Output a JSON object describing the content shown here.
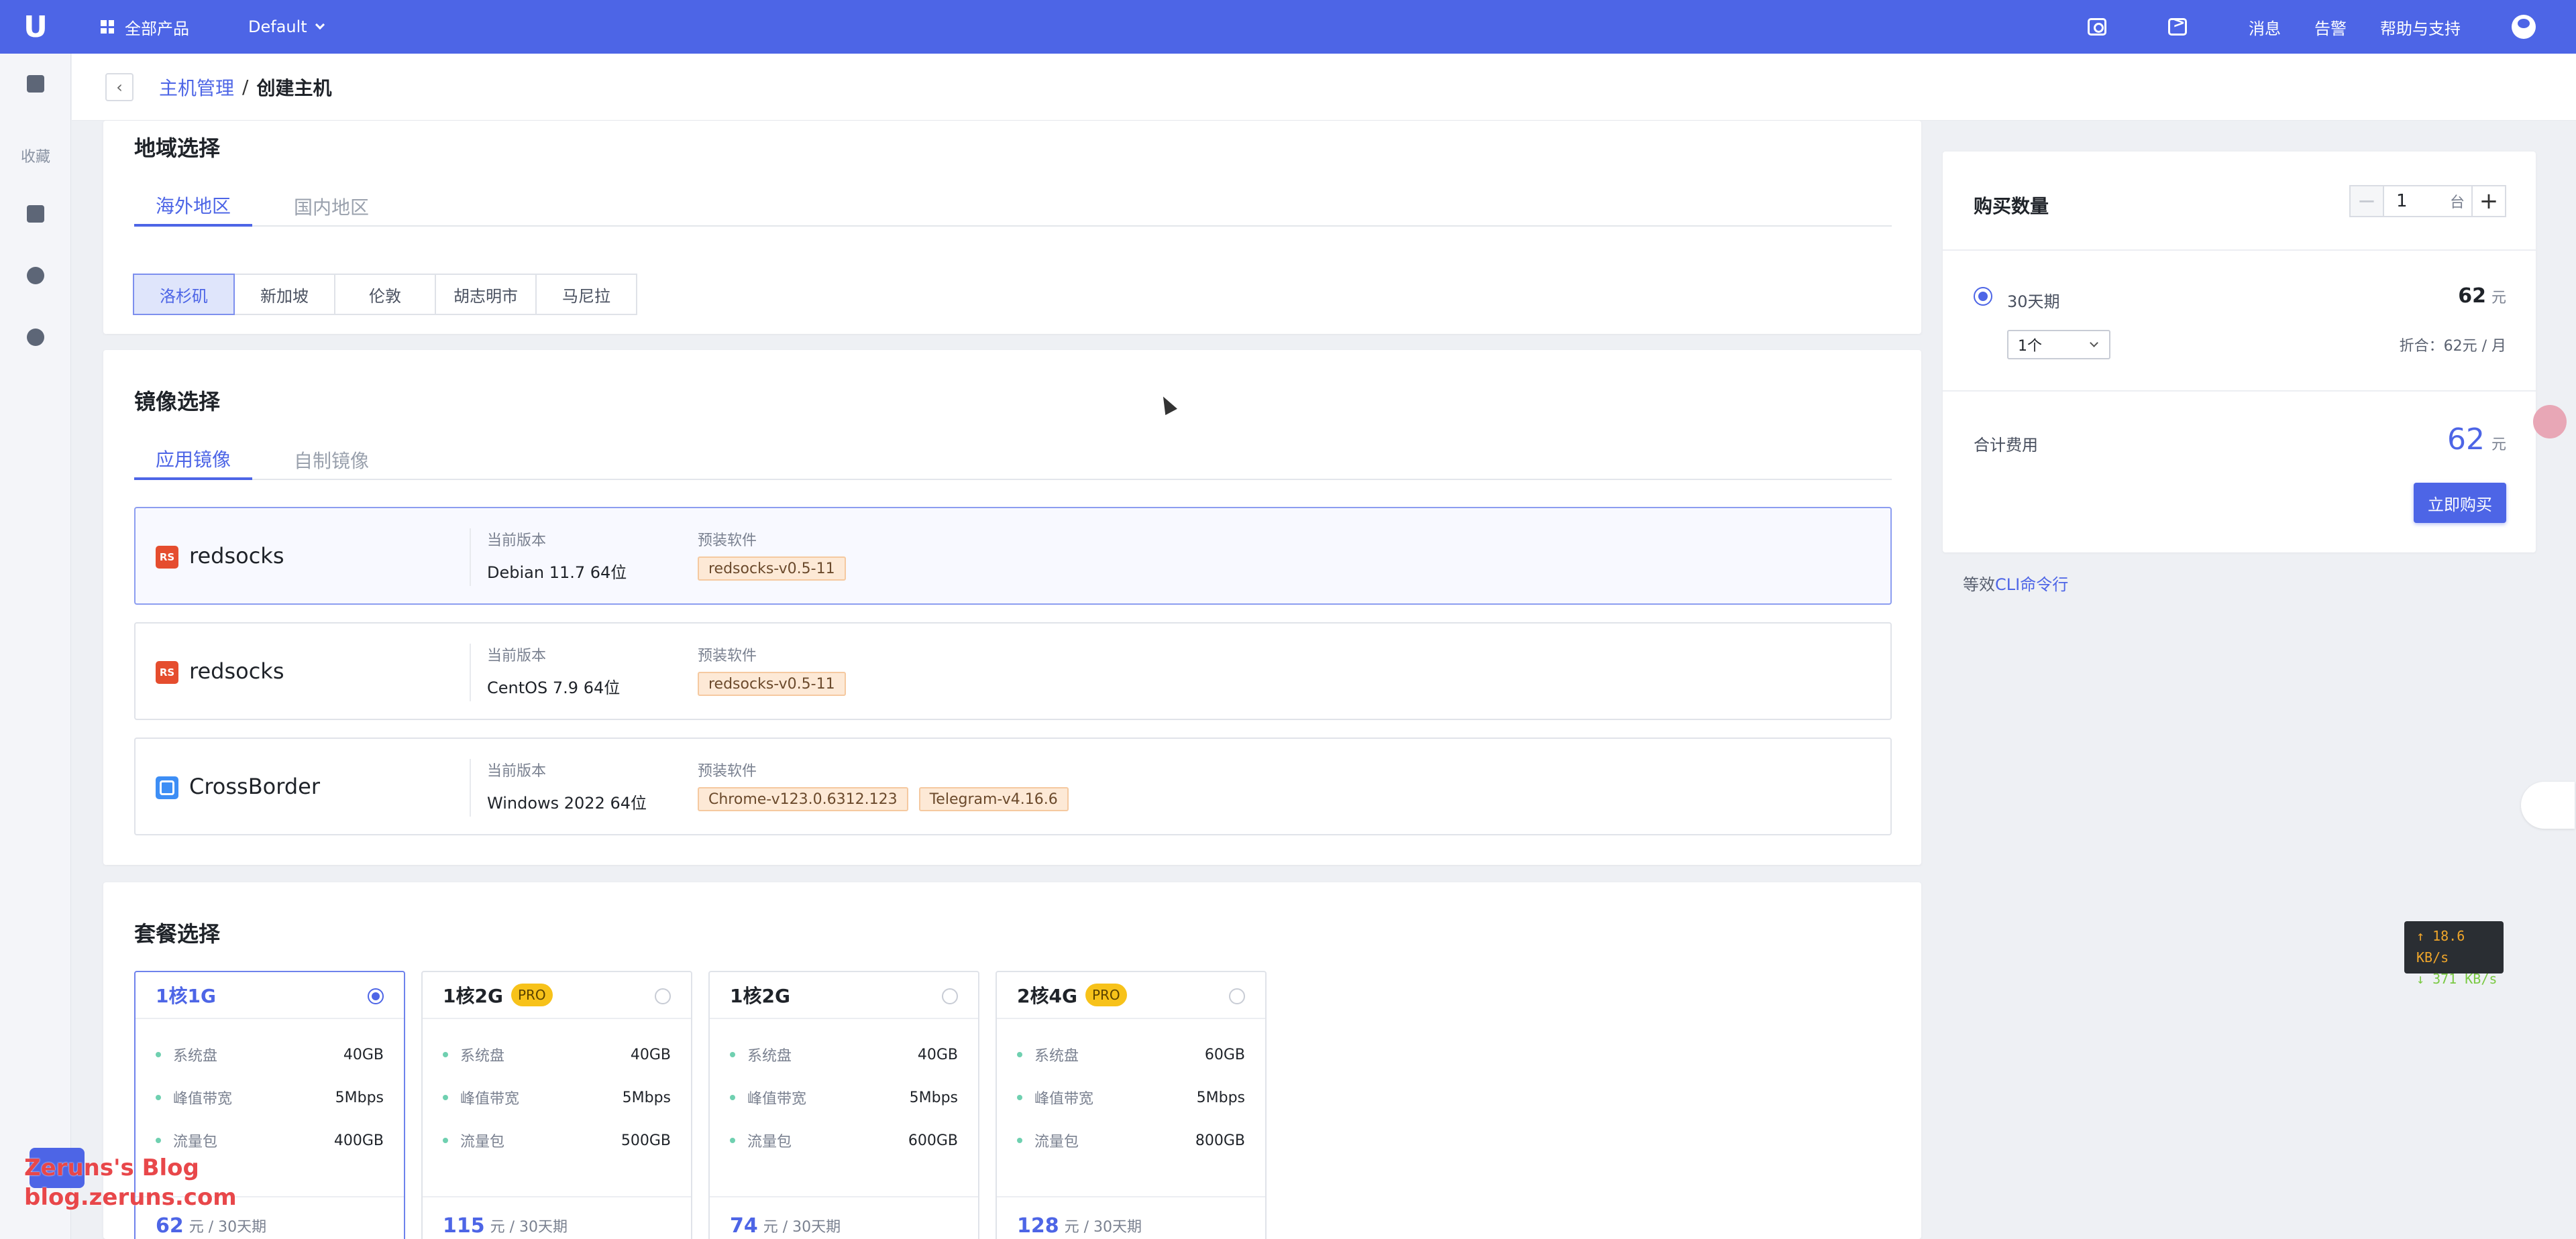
{
  "topbar": {
    "logo": "U",
    "all_products": "全部产品",
    "project": "Default",
    "links": [
      "消息",
      "告警",
      "帮助与支持"
    ],
    "bg_color": "#4d65e6"
  },
  "sidebar": {
    "favorites_label": "收藏"
  },
  "breadcrumb": {
    "back": "‹",
    "parent": "主机管理",
    "sep": "/",
    "current": "创建主机"
  },
  "region": {
    "title": "地域选择",
    "tabs": [
      "海外地区",
      "国内地区"
    ],
    "active_tab": 0,
    "cities": [
      "洛杉矶",
      "新加坡",
      "伦敦",
      "胡志明市",
      "马尼拉"
    ],
    "selected_city": 0
  },
  "image": {
    "title": "镜像选择",
    "tabs": [
      "应用镜像",
      "自制镜像"
    ],
    "active_tab": 0,
    "version_label": "当前版本",
    "software_label": "预装软件",
    "cards": [
      {
        "icon": "RS",
        "name": "redsocks",
        "version": "Debian 11.7 64位",
        "software": [
          "redsocks-v0.5-11"
        ],
        "selected": true
      },
      {
        "icon": "",
        "name": "redsocks",
        "version": "CentOS 7.9 64位",
        "software": [
          "redsocks-v0.5-11"
        ],
        "selected": false
      },
      {
        "icon": "",
        "name": "CrossBorder",
        "version": "Windows 2022 64位",
        "software": [
          "Chrome-v123.0.6312.123",
          "Telegram-v4.16.6"
        ],
        "selected": false
      }
    ]
  },
  "plans": {
    "title": "套餐选择",
    "spec_labels": [
      "系统盘",
      "峰值带宽",
      "流量包"
    ],
    "price_unit": "元 / 30天期",
    "items": [
      {
        "name": "1核1G",
        "pro": false,
        "specs": [
          "40GB",
          "5Mbps",
          "400GB"
        ],
        "price": "62",
        "selected": true
      },
      {
        "name": "1核2G",
        "pro": true,
        "specs": [
          "40GB",
          "5Mbps",
          "500GB"
        ],
        "price": "115",
        "selected": false
      },
      {
        "name": "1核2G",
        "pro": false,
        "specs": [
          "40GB",
          "5Mbps",
          "600GB"
        ],
        "price": "74",
        "selected": false
      },
      {
        "name": "2核4G",
        "pro": true,
        "specs": [
          "60GB",
          "5Mbps",
          "800GB"
        ],
        "price": "128",
        "selected": false
      }
    ],
    "pro_label": "PRO"
  },
  "summary": {
    "qty_title": "购买数量",
    "qty_minus": "−",
    "qty_plus": "+",
    "qty_value": "1",
    "qty_unit": "台",
    "period_label": "30天期",
    "period_price": "62",
    "currency": "元",
    "period_select": "1个",
    "discount": "折合：62元 / 月",
    "total_label": "合计费用",
    "total_price": "62",
    "buy_button": "立即购买",
    "cli_prefix": "等效",
    "cli_link": "CLI命令行"
  },
  "speed_widget": {
    "up": "↑ 18.6 KB/s",
    "down": "↓ 371 KB/s"
  },
  "watermark": {
    "line1": "Zeruns's Blog",
    "line2": "blog.zeruns.com"
  }
}
